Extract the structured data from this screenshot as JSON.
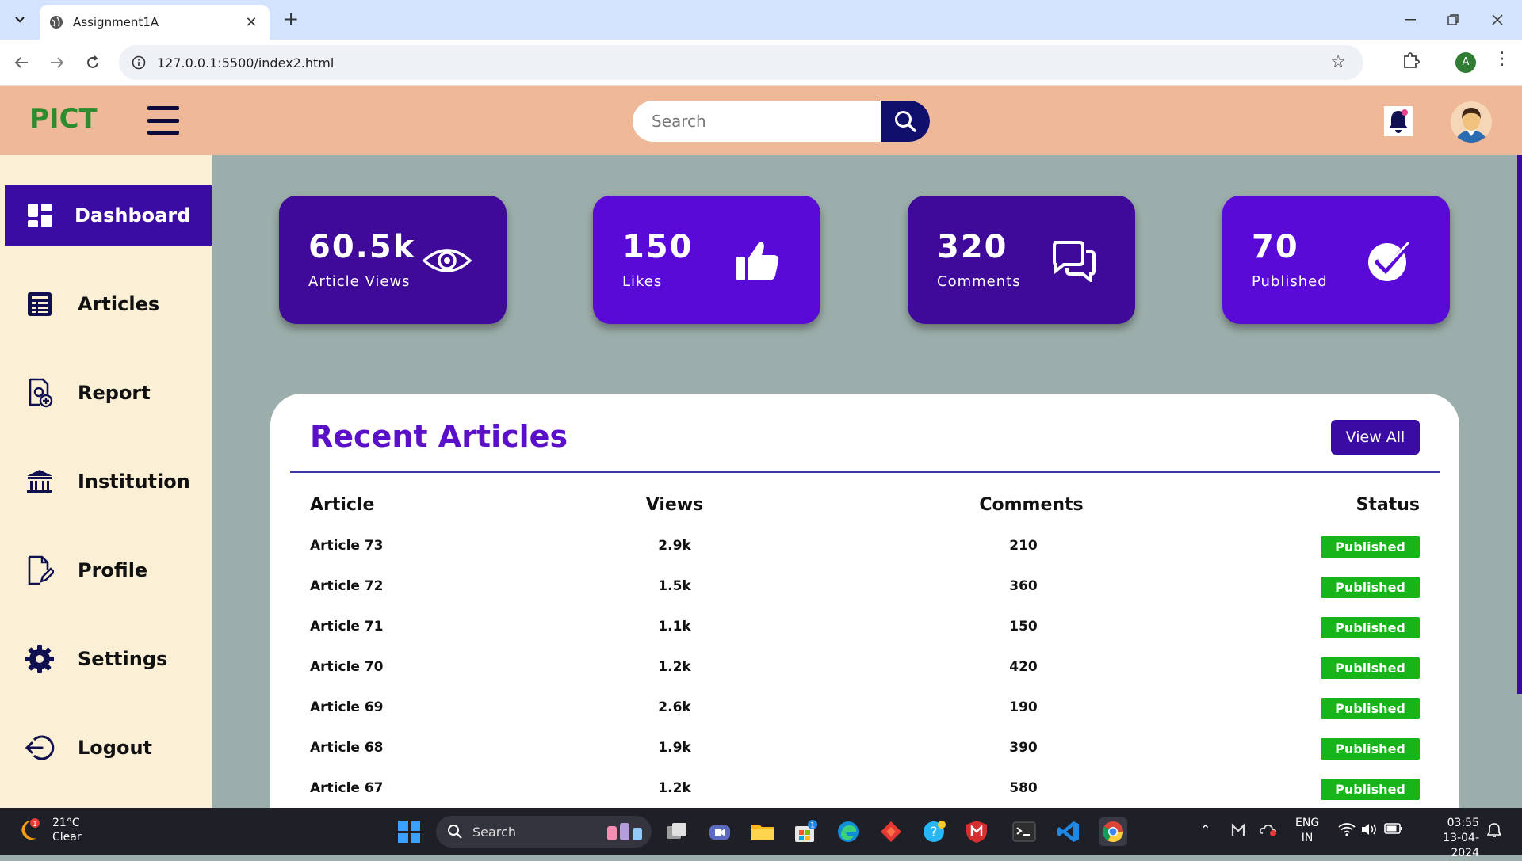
{
  "browser": {
    "tab_title": "Assignment1A",
    "tab_close": "✕",
    "new_tab": "+",
    "url": "127.0.0.1:5500/index2.html",
    "profile_initial": "A"
  },
  "header": {
    "brand": "PICT",
    "search_placeholder": "Search"
  },
  "sidebar": {
    "items": [
      {
        "label": "Dashboard",
        "icon": "dashboard-icon"
      },
      {
        "label": "Articles",
        "icon": "articles-icon"
      },
      {
        "label": "Report",
        "icon": "report-icon"
      },
      {
        "label": "Institution",
        "icon": "institution-icon"
      },
      {
        "label": "Profile",
        "icon": "profile-icon"
      },
      {
        "label": "Settings",
        "icon": "gear-icon"
      },
      {
        "label": "Logout",
        "icon": "logout-icon"
      }
    ],
    "active_color": "#3a0ca3"
  },
  "cards": [
    {
      "value": "60.5k",
      "label": "Article Views",
      "icon": "eye-icon",
      "color": "#3f0a9a"
    },
    {
      "value": "150",
      "label": "Likes",
      "icon": "thumbs-up-icon",
      "color": "#5a0ad6"
    },
    {
      "value": "320",
      "label": "Comments",
      "icon": "comments-icon",
      "color": "#3f0a9a"
    },
    {
      "value": "70",
      "label": "Published",
      "icon": "check-circle-icon",
      "color": "#5a0ad6"
    }
  ],
  "recent": {
    "title": "Recent Articles",
    "view_all": "View All",
    "columns": [
      "Article",
      "Views",
      "Comments",
      "Status"
    ],
    "rows": [
      {
        "article": "Article 73",
        "views": "2.9k",
        "comments": "210",
        "status": "Published"
      },
      {
        "article": "Article 72",
        "views": "1.5k",
        "comments": "360",
        "status": "Published"
      },
      {
        "article": "Article 71",
        "views": "1.1k",
        "comments": "150",
        "status": "Published"
      },
      {
        "article": "Article 70",
        "views": "1.2k",
        "comments": "420",
        "status": "Published"
      },
      {
        "article": "Article 69",
        "views": "2.6k",
        "comments": "190",
        "status": "Published"
      },
      {
        "article": "Article 68",
        "views": "1.9k",
        "comments": "390",
        "status": "Published"
      },
      {
        "article": "Article 67",
        "views": "1.2k",
        "comments": "580",
        "status": "Published"
      }
    ],
    "status_color": "#17b41a"
  },
  "taskbar": {
    "weather_temp": "21°C",
    "weather_desc": "Clear",
    "weather_badge": "1",
    "search_label": "Search",
    "store_badge": "1",
    "lang_top": "ENG",
    "lang_bottom": "IN",
    "time": "03:55",
    "date": "13-04-2024"
  }
}
